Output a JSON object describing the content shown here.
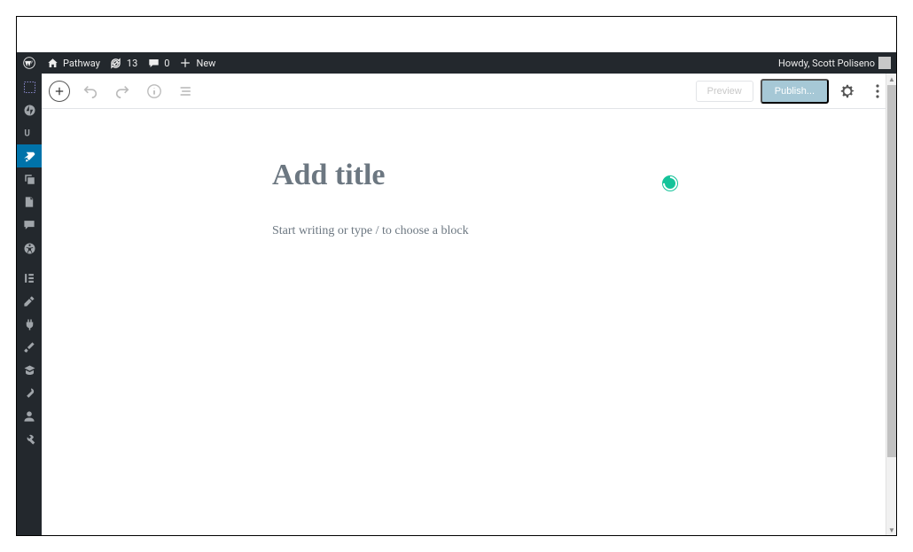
{
  "adminbar": {
    "site_name": "Pathway",
    "updates_count": "13",
    "comments_count": "0",
    "new_label": "New",
    "howdy": "Howdy, Scott Poliseno"
  },
  "sidebar": {
    "items": [
      {
        "name": "dashboard",
        "active": false
      },
      {
        "name": "jetpack",
        "active": false
      },
      {
        "name": "updraft",
        "active": false
      },
      {
        "name": "posts",
        "active": true
      },
      {
        "name": "media",
        "active": false
      },
      {
        "name": "pages",
        "active": false
      },
      {
        "name": "comments",
        "active": false
      },
      {
        "name": "accessibility",
        "active": false
      },
      {
        "name": "elementor",
        "active": false
      },
      {
        "name": "appearance",
        "active": false
      },
      {
        "name": "plugins",
        "active": false
      },
      {
        "name": "tools-brush",
        "active": false
      },
      {
        "name": "learndash",
        "active": false
      },
      {
        "name": "tools-wrench",
        "active": false
      },
      {
        "name": "users",
        "active": false
      },
      {
        "name": "settings",
        "active": false
      }
    ]
  },
  "toolbar": {
    "preview_label": "Preview",
    "publish_label": "Publish..."
  },
  "editor": {
    "title_placeholder": "Add title",
    "body_placeholder": "Start writing or type / to choose a block"
  }
}
